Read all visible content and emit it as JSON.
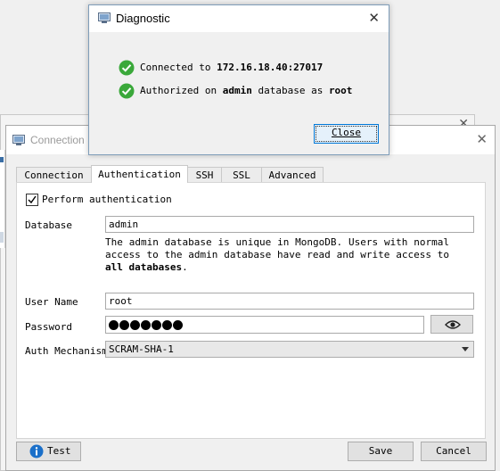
{
  "connection_window": {
    "title": "Connection",
    "tabs": [
      {
        "label": "Connection"
      },
      {
        "label": "Authentication"
      },
      {
        "label": "SSH"
      },
      {
        "label": "SSL"
      },
      {
        "label": "Advanced"
      }
    ],
    "active_tab": "Authentication",
    "auth": {
      "perform_auth_label": "Perform authentication",
      "perform_auth_checked": true,
      "database_label": "Database",
      "database_value": "admin",
      "help_part1": "The admin database is unique in MongoDB. Users with normal access to the admin database have read and write access to ",
      "help_bold": "all databases",
      "help_part2": ".",
      "username_label": "User Name",
      "username_value": "root",
      "password_label": "Password",
      "password_length": 7,
      "auth_mechanism_label": "Auth Mechanism",
      "auth_mechanism_value": "SCRAM-SHA-1"
    },
    "buttons": {
      "test": "Test",
      "save": "Save",
      "cancel": "Cancel"
    }
  },
  "diagnostic": {
    "title": "Diagnostic",
    "line1_prefix": "Connected to ",
    "line1_host": "172.16.18.40:27017",
    "line2_prefix": "Authorized on ",
    "line2_db": "admin",
    "line2_mid": " database as ",
    "line2_user": "root",
    "close_label": "Close"
  },
  "icons": {
    "success": "check-circle-icon",
    "info": "info-icon",
    "eye": "eye-icon",
    "window": "window-icon"
  },
  "colors": {
    "success_green": "#3aa83a",
    "info_blue": "#1a6fc9",
    "focus_blue": "#0078d7"
  }
}
